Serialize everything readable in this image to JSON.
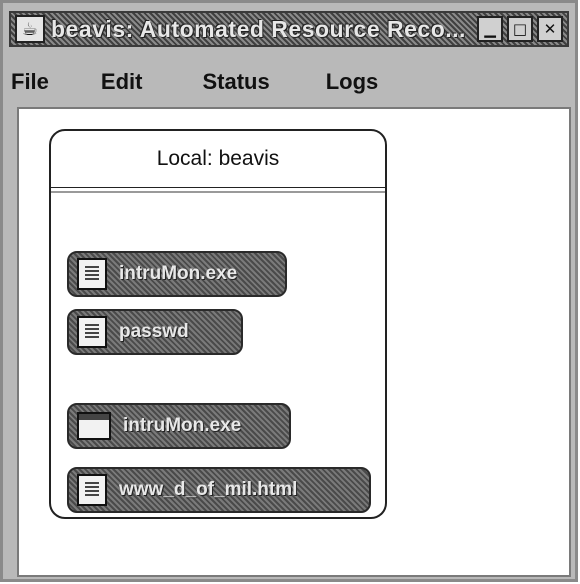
{
  "window": {
    "title": "beavis: Automated Resource Reco...",
    "app_icon": "coffee-cup-icon",
    "buttons": {
      "minimize": "minimize-icon",
      "maximize": "maximize-icon",
      "close": "close-icon"
    }
  },
  "menu": {
    "items": [
      {
        "label": "File"
      },
      {
        "label": "Edit"
      },
      {
        "label": "Status"
      },
      {
        "label": "Logs"
      }
    ]
  },
  "host_panel": {
    "title": "Local: beavis",
    "resources": [
      {
        "label": "intruMon.exe",
        "icon": "file-icon"
      },
      {
        "label": "passwd",
        "icon": "file-icon"
      },
      {
        "label": "intruMon.exe",
        "icon": "window-icon"
      },
      {
        "label": "www_d_of_mil.html",
        "icon": "file-icon"
      }
    ]
  }
}
